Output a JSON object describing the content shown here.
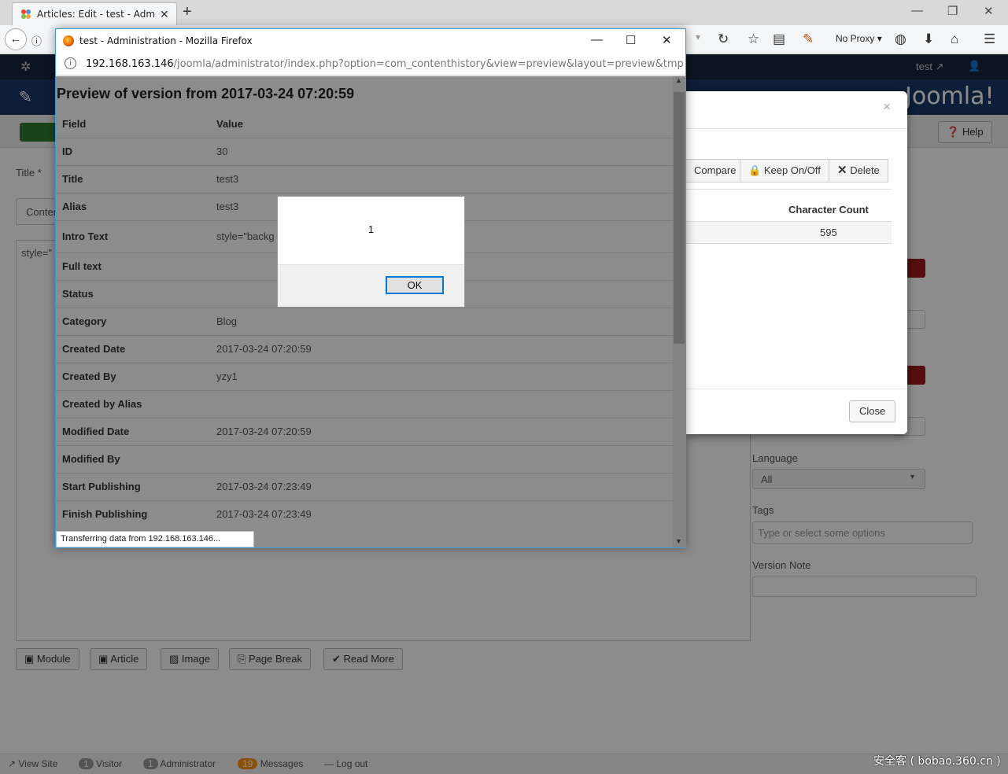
{
  "browser": {
    "tab_title": "Articles: Edit - test - Admi...",
    "proxy_label": "No Proxy"
  },
  "joomla": {
    "user_label": "test",
    "logo_text": "Joomla!",
    "help_label": "Help",
    "title_label": "Title *",
    "content_tab": "Conten",
    "editor_text": "style=\"",
    "language_label": "Language",
    "language_value": "All",
    "tags_label": "Tags",
    "tags_placeholder": "Type or select some options",
    "version_note_label": "Version Note",
    "editor_buttons": [
      "Module",
      "Article",
      "Image",
      "Page Break",
      "Read More"
    ],
    "status": {
      "view_site": "View Site",
      "visitor_count": "1",
      "visitor_label": "Visitor",
      "admin_count": "1",
      "admin_label": "Administrator",
      "messages_count": "19",
      "messages_label": "Messages",
      "logout": "Log out"
    }
  },
  "history_modal": {
    "close_x": "×",
    "compare": "Compare",
    "keep": "Keep On/Off",
    "delete": "Delete",
    "col_char_count": "Character Count",
    "char_count_value": "595",
    "close_button": "Close"
  },
  "popup": {
    "window_title": "test - Administration - Mozilla Firefox",
    "url_host": "192.168.163.146",
    "url_rest": "/joomla/administrator/index.php?option=com_contenthistory&view=preview&layout=preview&tmpl=com",
    "heading": "Preview of version from 2017-03-24 07:20:59",
    "col_field": "Field",
    "col_value": "Value",
    "rows": [
      {
        "field": "ID",
        "value": "30"
      },
      {
        "field": "Title",
        "value": "test3"
      },
      {
        "field": "Alias",
        "value": "test3"
      },
      {
        "field": "Intro Text",
        "value": "style=\"backg"
      },
      {
        "field": "Full text",
        "value": ""
      },
      {
        "field": "Status",
        "value": ""
      },
      {
        "field": "Category",
        "value": "Blog"
      },
      {
        "field": "Created Date",
        "value": "2017-03-24 07:20:59"
      },
      {
        "field": "Created By",
        "value": "yzy1"
      },
      {
        "field": "Created by Alias",
        "value": ""
      },
      {
        "field": "Modified Date",
        "value": "2017-03-24 07:20:59"
      },
      {
        "field": "Modified By",
        "value": ""
      },
      {
        "field": "Start Publishing",
        "value": "2017-03-24 07:23:49"
      },
      {
        "field": "Finish Publishing",
        "value": "2017-03-24 07:23:49"
      }
    ],
    "status_text": "Transferring data from 192.168.163.146..."
  },
  "alert": {
    "message": "1",
    "ok_label": "OK"
  },
  "watermark": "安全客 ( bobao.360.cn )"
}
